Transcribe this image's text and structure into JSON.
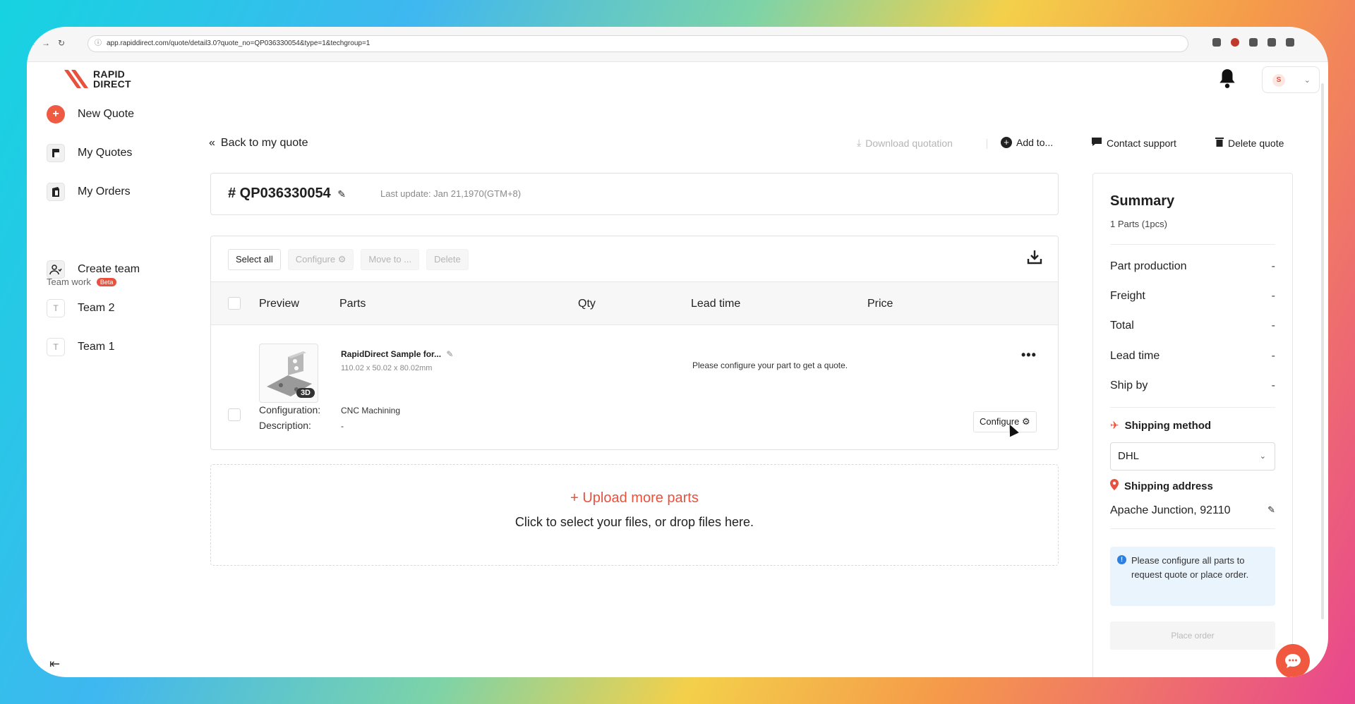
{
  "browser": {
    "url": "app.rapiddirect.com/quote/detail3.0?quote_no=QP036330054&type=1&techgroup=1"
  },
  "brand": {
    "line1": "RAPID",
    "line2": "DIRECT",
    "color": "#e8513d"
  },
  "user": {
    "initial": "S"
  },
  "sidebar": {
    "items": [
      {
        "label": "New Quote",
        "icon": "plus-circle-icon"
      },
      {
        "label": "My Quotes",
        "icon": "quotes-icon"
      },
      {
        "label": "My Orders",
        "icon": "orders-icon"
      }
    ],
    "team_work": {
      "label": "Team work",
      "badge": "Beta"
    },
    "team_items": [
      {
        "label": "Create team",
        "icon": "create-team-icon"
      },
      {
        "label": "Team 2",
        "icon": "T"
      },
      {
        "label": "Team 1",
        "icon": "T"
      }
    ]
  },
  "actions": {
    "back": "Back to my quote",
    "download": "Download quotation",
    "add_to": "Add to...",
    "contact": "Contact support",
    "delete_quote": "Delete quote"
  },
  "quote": {
    "number": "# QP036330054",
    "last_update": "Last update: Jan 21,1970(GTM+8)"
  },
  "toolbar": {
    "select_all": "Select all",
    "configure": "Configure",
    "move_to": "Move to ...",
    "delete": "Delete"
  },
  "table": {
    "headers": [
      "Preview",
      "Parts",
      "Qty",
      "Lead time",
      "Price"
    ],
    "row": {
      "badge": "3D",
      "name": "RapidDirect Sample for...",
      "dimensions": "110.02 x 50.02 x 80.02mm",
      "message": "Please configure your part to get a quote.",
      "more": "•••",
      "config_label": "Configuration:",
      "config_value": "CNC Machining",
      "desc_label": "Description:",
      "desc_value": "-",
      "configure_btn": "Configure"
    }
  },
  "upload": {
    "title": "+ Upload more parts",
    "subtitle": "Click to select your files, or drop files here."
  },
  "summary": {
    "title": "Summary",
    "subtitle": "1 Parts (1pcs)",
    "rows": [
      {
        "label": "Part production",
        "value": "-"
      },
      {
        "label": "Freight",
        "value": "-"
      },
      {
        "label": "Total",
        "value": "-"
      },
      {
        "label": "Lead time",
        "value": "-"
      },
      {
        "label": "Ship by",
        "value": "-"
      }
    ],
    "shipping_method_label": "Shipping method",
    "shipping_method_value": "DHL",
    "shipping_address_label": "Shipping address",
    "shipping_address_value": "Apache Junction, 92110",
    "notice": "Please configure all parts to request quote or place order.",
    "place_order": "Place order"
  }
}
